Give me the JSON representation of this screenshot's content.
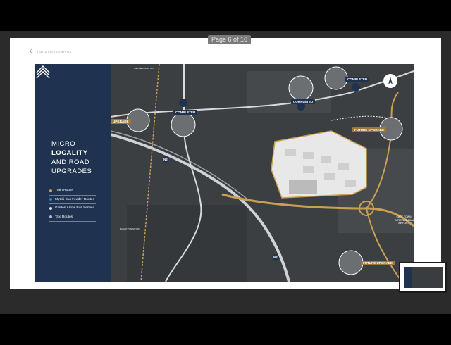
{
  "viewer": {
    "page_indicator": "Page 6 of 16"
  },
  "page": {
    "number": "6",
    "header_text": "NIMBLE ARK INDUSTRIES"
  },
  "panel": {
    "title_line1": "MICRO",
    "title_line2": "LOCALITY",
    "title_line3": "AND ROAD",
    "title_line4": "UPGRADES",
    "legend": [
      {
        "label": "Train Route",
        "color": "#c9a052"
      },
      {
        "label": "MyCiti Bus Feeder Routes",
        "color": "#3b7fc4"
      },
      {
        "label": "Golden Arrow Bus Service",
        "color": "#e0e0e0"
      },
      {
        "label": "Taxi Routes",
        "color": "#b0b8c4"
      }
    ]
  },
  "map": {
    "labels": {
      "completed_1": "COMPLETED",
      "completed_2": "COMPLETED",
      "completed_3": "COMPLETED",
      "future_1": "FUTURE UPGRADE",
      "future_2": "FUTURE UPGRADE",
      "upgrade_left": "UPGRADE",
      "highway_n2_a": "N2",
      "highway_n2_b": "N2",
      "airport": "CAPE TOWN INTERNATIONAL AIRPORT",
      "station_top": "NETREG STATION",
      "station_bottom": "PHILIPPI STATION"
    },
    "colors": {
      "road": "#d9d9d9",
      "future_road": "#c9a052",
      "site_fill": "#e8e8e8"
    }
  }
}
